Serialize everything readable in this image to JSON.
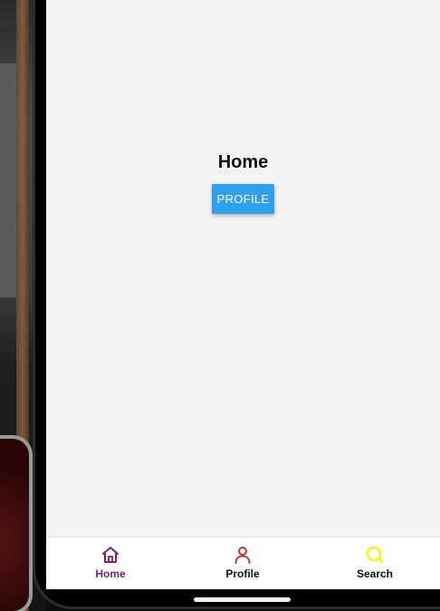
{
  "screen": {
    "title": "Home",
    "profile_button_label": "PROFILE"
  },
  "tabbar": {
    "items": [
      {
        "label": "Home",
        "icon": "home-icon",
        "color": "#7b2180",
        "active": true
      },
      {
        "label": "Profile",
        "icon": "user-icon",
        "color": "#c0392b",
        "active": false
      },
      {
        "label": "Search",
        "icon": "search-icon",
        "color": "#f4f13a",
        "active": false
      }
    ]
  },
  "colors": {
    "button": "#2f9ff0",
    "screen_background": "#f3f3f3",
    "active_tab": "#7b2180"
  }
}
